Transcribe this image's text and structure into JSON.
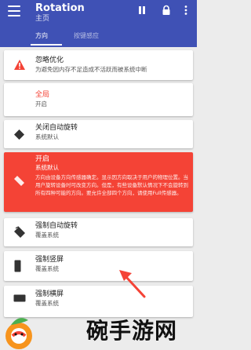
{
  "appbar": {
    "title": "Rotation",
    "subtitle": "主页",
    "icons": [
      "menu-icon",
      "pause-icon",
      "lock-icon",
      "more-icon"
    ]
  },
  "tabs": [
    {
      "label": "方向",
      "active": true
    },
    {
      "label": "按键感应",
      "active": false
    }
  ],
  "cards": {
    "optimize": {
      "title": "忽略优化",
      "sub": "为避免因内存不足造成不活跃而被系统中断",
      "icon": "warning-icon"
    },
    "global": {
      "title": "全局",
      "sub": "开启"
    },
    "off": {
      "title": "关闭自动旋转",
      "sub": "系统默认",
      "icon": "rotate-diamond-icon"
    },
    "on": {
      "title": "开启",
      "sub": "系统默认",
      "body": "方向由设备方向传感器确定。显示因方向取决于用户的物理位置。当用户旋转设备时可改变方向。但是，有些设备默认情况下不会旋转到所有四种可能的方向。要允许全部四个方向，请使用Full传感器。",
      "icon": "eraser-icon"
    },
    "force_auto": {
      "title": "强制自动旋转",
      "sub": "覆盖系统",
      "icon": "rotate-auto-icon"
    },
    "force_portrait": {
      "title": "强制竖屏",
      "sub": "覆盖系统",
      "icon": "portrait-icon"
    },
    "force_landscape": {
      "title": "强制横屏",
      "sub": "覆盖系统",
      "icon": "landscape-icon"
    }
  },
  "watermark": {
    "text": "碗手游网"
  },
  "colors": {
    "primary": "#3f51b5",
    "accent": "#f44336",
    "background": "#ececec"
  }
}
